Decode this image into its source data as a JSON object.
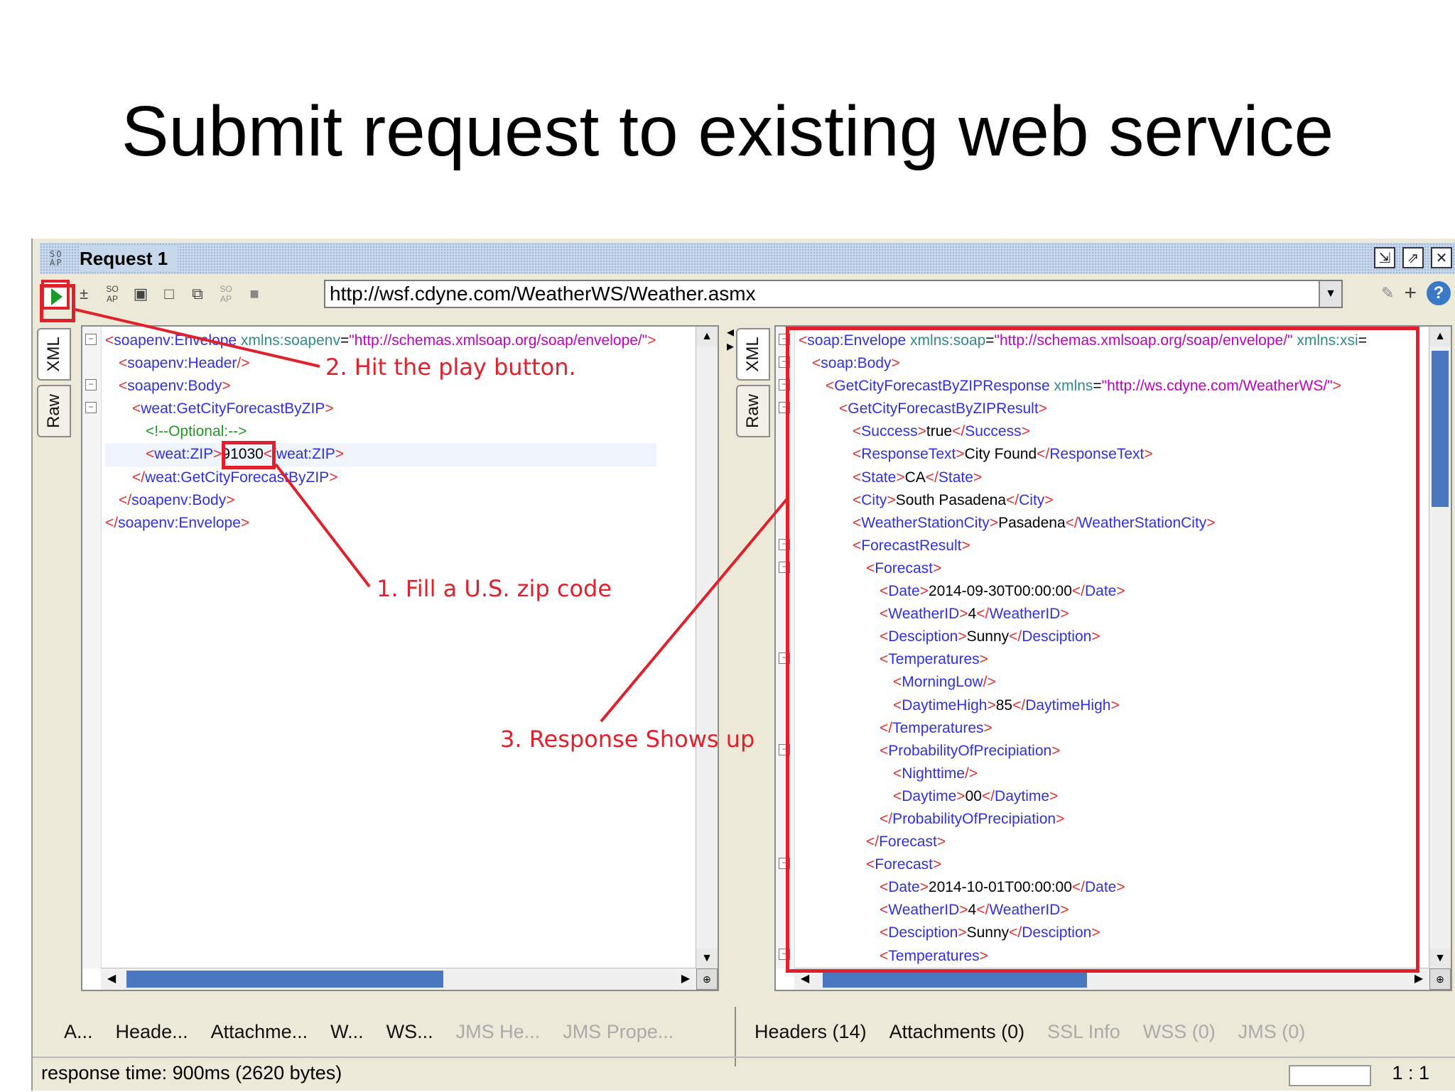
{
  "slide": {
    "title": "Submit request to existing web service"
  },
  "window": {
    "title": "Request 1",
    "title_icon": "so-ap-icon",
    "buttons": [
      "restore-icon",
      "detach-icon",
      "close-icon"
    ]
  },
  "toolbar": {
    "url": "http://wsf.cdyne.com/WeatherWS/Weather.asmx",
    "tools": [
      "add-step-icon",
      "soap-icon",
      "frame-icon",
      "square-icon",
      "copy-icon",
      "soap-gray-icon",
      "stop-icon"
    ]
  },
  "request": {
    "tabs": [
      "XML",
      "Raw"
    ],
    "lines": [
      {
        "i": 0,
        "p": [
          [
            "b",
            "<"
          ],
          [
            "t",
            "soapenv:Envelope "
          ],
          [
            "a",
            "xmlns:soapenv"
          ],
          [
            "x",
            "="
          ],
          [
            "s",
            "\"http://schemas.xmlsoap.org/soap/envelope/\""
          ],
          [
            "b",
            ">"
          ]
        ]
      },
      {
        "i": 1,
        "p": [
          [
            "b",
            "<"
          ],
          [
            "t",
            "soapenv:Header"
          ],
          [
            "b",
            "/>"
          ]
        ]
      },
      {
        "i": 1,
        "p": [
          [
            "b",
            "<"
          ],
          [
            "t",
            "soapenv:Body"
          ],
          [
            "b",
            ">"
          ]
        ]
      },
      {
        "i": 2,
        "p": [
          [
            "b",
            "<"
          ],
          [
            "t",
            "weat:GetCityForecastByZIP"
          ],
          [
            "b",
            ">"
          ]
        ]
      },
      {
        "i": 3,
        "p": [
          [
            "c",
            "<!--Optional:-->"
          ]
        ]
      },
      {
        "i": 3,
        "p": [
          [
            "b",
            "<"
          ],
          [
            "t",
            "weat:ZIP"
          ],
          [
            "b",
            ">"
          ],
          [
            "x",
            "91030"
          ],
          [
            "b",
            "</"
          ],
          [
            "t",
            "weat:ZIP"
          ],
          [
            "b",
            ">"
          ]
        ]
      },
      {
        "i": 2,
        "p": [
          [
            "b",
            "</"
          ],
          [
            "t",
            "weat:GetCityForecastByZIP"
          ],
          [
            "b",
            ">"
          ]
        ]
      },
      {
        "i": 1,
        "p": [
          [
            "b",
            "</"
          ],
          [
            "t",
            "soapenv:Body"
          ],
          [
            "b",
            ">"
          ]
        ]
      },
      {
        "i": 0,
        "p": [
          [
            "b",
            "</"
          ],
          [
            "t",
            "soapenv:Envelope"
          ],
          [
            "b",
            ">"
          ]
        ]
      }
    ],
    "bottom_tabs": [
      {
        "label": "A...",
        "enabled": true
      },
      {
        "label": "Heade...",
        "enabled": true
      },
      {
        "label": "Attachme...",
        "enabled": true
      },
      {
        "label": "W...",
        "enabled": true
      },
      {
        "label": "WS...",
        "enabled": true
      },
      {
        "label": "JMS He...",
        "enabled": false
      },
      {
        "label": "JMS Prope...",
        "enabled": false
      }
    ]
  },
  "response": {
    "tabs": [
      "XML",
      "Raw"
    ],
    "lines": [
      {
        "i": 0,
        "p": [
          [
            "b",
            "<"
          ],
          [
            "t",
            "soap:Envelope "
          ],
          [
            "a",
            "xmlns:soap"
          ],
          [
            "x",
            "="
          ],
          [
            "s",
            "\"http://schemas.xmlsoap.org/soap/envelope/\" "
          ],
          [
            "a",
            "xmlns:xsi"
          ],
          [
            "x",
            "="
          ]
        ]
      },
      {
        "i": 1,
        "p": [
          [
            "b",
            "<"
          ],
          [
            "t",
            "soap:Body"
          ],
          [
            "b",
            ">"
          ]
        ]
      },
      {
        "i": 2,
        "p": [
          [
            "b",
            "<"
          ],
          [
            "t",
            "GetCityForecastByZIPResponse "
          ],
          [
            "a",
            "xmlns"
          ],
          [
            "x",
            "="
          ],
          [
            "s",
            "\"http://ws.cdyne.com/WeatherWS/\""
          ],
          [
            "b",
            ">"
          ]
        ]
      },
      {
        "i": 3,
        "p": [
          [
            "b",
            "<"
          ],
          [
            "t",
            "GetCityForecastByZIPResult"
          ],
          [
            "b",
            ">"
          ]
        ]
      },
      {
        "i": 4,
        "p": [
          [
            "b",
            "<"
          ],
          [
            "t",
            "Success"
          ],
          [
            "b",
            ">"
          ],
          [
            "x",
            "true"
          ],
          [
            "b",
            "</"
          ],
          [
            "t",
            "Success"
          ],
          [
            "b",
            ">"
          ]
        ]
      },
      {
        "i": 4,
        "p": [
          [
            "b",
            "<"
          ],
          [
            "t",
            "ResponseText"
          ],
          [
            "b",
            ">"
          ],
          [
            "x",
            "City Found"
          ],
          [
            "b",
            "</"
          ],
          [
            "t",
            "ResponseText"
          ],
          [
            "b",
            ">"
          ]
        ]
      },
      {
        "i": 4,
        "p": [
          [
            "b",
            "<"
          ],
          [
            "t",
            "State"
          ],
          [
            "b",
            ">"
          ],
          [
            "x",
            "CA"
          ],
          [
            "b",
            "</"
          ],
          [
            "t",
            "State"
          ],
          [
            "b",
            ">"
          ]
        ]
      },
      {
        "i": 4,
        "p": [
          [
            "b",
            "<"
          ],
          [
            "t",
            "City"
          ],
          [
            "b",
            ">"
          ],
          [
            "x",
            "South Pasadena"
          ],
          [
            "b",
            "</"
          ],
          [
            "t",
            "City"
          ],
          [
            "b",
            ">"
          ]
        ]
      },
      {
        "i": 4,
        "p": [
          [
            "b",
            "<"
          ],
          [
            "t",
            "WeatherStationCity"
          ],
          [
            "b",
            ">"
          ],
          [
            "x",
            "Pasadena"
          ],
          [
            "b",
            "</"
          ],
          [
            "t",
            "WeatherStationCity"
          ],
          [
            "b",
            ">"
          ]
        ]
      },
      {
        "i": 4,
        "p": [
          [
            "b",
            "<"
          ],
          [
            "t",
            "ForecastResult"
          ],
          [
            "b",
            ">"
          ]
        ]
      },
      {
        "i": 5,
        "p": [
          [
            "b",
            "<"
          ],
          [
            "t",
            "Forecast"
          ],
          [
            "b",
            ">"
          ]
        ]
      },
      {
        "i": 6,
        "p": [
          [
            "b",
            "<"
          ],
          [
            "t",
            "Date"
          ],
          [
            "b",
            ">"
          ],
          [
            "x",
            "2014-09-30T00:00:00"
          ],
          [
            "b",
            "</"
          ],
          [
            "t",
            "Date"
          ],
          [
            "b",
            ">"
          ]
        ]
      },
      {
        "i": 6,
        "p": [
          [
            "b",
            "<"
          ],
          [
            "t",
            "WeatherID"
          ],
          [
            "b",
            ">"
          ],
          [
            "x",
            "4"
          ],
          [
            "b",
            "</"
          ],
          [
            "t",
            "WeatherID"
          ],
          [
            "b",
            ">"
          ]
        ]
      },
      {
        "i": 6,
        "p": [
          [
            "b",
            "<"
          ],
          [
            "t",
            "Desciption"
          ],
          [
            "b",
            ">"
          ],
          [
            "x",
            "Sunny"
          ],
          [
            "b",
            "</"
          ],
          [
            "t",
            "Desciption"
          ],
          [
            "b",
            ">"
          ]
        ]
      },
      {
        "i": 6,
        "p": [
          [
            "b",
            "<"
          ],
          [
            "t",
            "Temperatures"
          ],
          [
            "b",
            ">"
          ]
        ]
      },
      {
        "i": 7,
        "p": [
          [
            "b",
            "<"
          ],
          [
            "t",
            "MorningLow"
          ],
          [
            "b",
            "/>"
          ]
        ]
      },
      {
        "i": 7,
        "p": [
          [
            "b",
            "<"
          ],
          [
            "t",
            "DaytimeHigh"
          ],
          [
            "b",
            ">"
          ],
          [
            "x",
            "85"
          ],
          [
            "b",
            "</"
          ],
          [
            "t",
            "DaytimeHigh"
          ],
          [
            "b",
            ">"
          ]
        ]
      },
      {
        "i": 6,
        "p": [
          [
            "b",
            "</"
          ],
          [
            "t",
            "Temperatures"
          ],
          [
            "b",
            ">"
          ]
        ]
      },
      {
        "i": 6,
        "p": [
          [
            "b",
            "<"
          ],
          [
            "t",
            "ProbabilityOfPrecipiation"
          ],
          [
            "b",
            ">"
          ]
        ]
      },
      {
        "i": 7,
        "p": [
          [
            "b",
            "<"
          ],
          [
            "t",
            "Nighttime"
          ],
          [
            "b",
            "/>"
          ]
        ]
      },
      {
        "i": 7,
        "p": [
          [
            "b",
            "<"
          ],
          [
            "t",
            "Daytime"
          ],
          [
            "b",
            ">"
          ],
          [
            "x",
            "00"
          ],
          [
            "b",
            "</"
          ],
          [
            "t",
            "Daytime"
          ],
          [
            "b",
            ">"
          ]
        ]
      },
      {
        "i": 6,
        "p": [
          [
            "b",
            "</"
          ],
          [
            "t",
            "ProbabilityOfPrecipiation"
          ],
          [
            "b",
            ">"
          ]
        ]
      },
      {
        "i": 5,
        "p": [
          [
            "b",
            "</"
          ],
          [
            "t",
            "Forecast"
          ],
          [
            "b",
            ">"
          ]
        ]
      },
      {
        "i": 5,
        "p": [
          [
            "b",
            "<"
          ],
          [
            "t",
            "Forecast"
          ],
          [
            "b",
            ">"
          ]
        ]
      },
      {
        "i": 6,
        "p": [
          [
            "b",
            "<"
          ],
          [
            "t",
            "Date"
          ],
          [
            "b",
            ">"
          ],
          [
            "x",
            "2014-10-01T00:00:00"
          ],
          [
            "b",
            "</"
          ],
          [
            "t",
            "Date"
          ],
          [
            "b",
            ">"
          ]
        ]
      },
      {
        "i": 6,
        "p": [
          [
            "b",
            "<"
          ],
          [
            "t",
            "WeatherID"
          ],
          [
            "b",
            ">"
          ],
          [
            "x",
            "4"
          ],
          [
            "b",
            "</"
          ],
          [
            "t",
            "WeatherID"
          ],
          [
            "b",
            ">"
          ]
        ]
      },
      {
        "i": 6,
        "p": [
          [
            "b",
            "<"
          ],
          [
            "t",
            "Desciption"
          ],
          [
            "b",
            ">"
          ],
          [
            "x",
            "Sunny"
          ],
          [
            "b",
            "</"
          ],
          [
            "t",
            "Desciption"
          ],
          [
            "b",
            ">"
          ]
        ]
      },
      {
        "i": 6,
        "p": [
          [
            "b",
            "<"
          ],
          [
            "t",
            "Temperatures"
          ],
          [
            "b",
            ">"
          ]
        ]
      }
    ],
    "bottom_tabs": [
      {
        "label": "Headers (14)",
        "enabled": true
      },
      {
        "label": "Attachments (0)",
        "enabled": true
      },
      {
        "label": "SSL Info",
        "enabled": false
      },
      {
        "label": "WSS (0)",
        "enabled": false
      },
      {
        "label": "JMS (0)",
        "enabled": false
      }
    ]
  },
  "status": {
    "response_time": "response time: 900ms (2620 bytes)",
    "position": "1 : 1"
  },
  "annotations": {
    "step1": "1. Fill a U.S. zip code",
    "step2": "2. Hit the play button.",
    "step3": "3. Response Shows up"
  },
  "colors": {
    "tag": "#3030e0",
    "bracket": "#e03030",
    "attr": "#2e8b8b",
    "string": "#c000c0",
    "comment": "#1f9a1f",
    "annotation": "#e0202a"
  }
}
